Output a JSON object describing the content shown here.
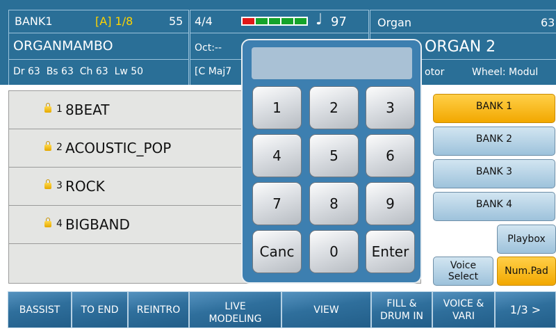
{
  "style_info": {
    "bank": "BANK1",
    "position": "[A] 1/8",
    "number": "55",
    "name": "ORGANMAMBO",
    "levels": "Dr 63  Bs 63  Ch 63  Lw 50"
  },
  "song_info": {
    "time_signature": "4/4",
    "tempo": "97",
    "octave": "Oct:--",
    "chord": "[C Maj7"
  },
  "voice_info": {
    "name": "Organ",
    "number": "63",
    "voice_title": "ORGAN 2",
    "rotor": "otor",
    "wheel": "Wheel: Modul"
  },
  "styles": [
    {
      "num": "1",
      "name": "8BEAT"
    },
    {
      "num": "2",
      "name": "ACOUSTIC_POP"
    },
    {
      "num": "3",
      "name": "ROCK"
    },
    {
      "num": "4",
      "name": "BIGBAND"
    }
  ],
  "numpad": {
    "display": "",
    "keys": [
      "1",
      "2",
      "3",
      "4",
      "5",
      "6",
      "7",
      "8",
      "9",
      "Canc",
      "0",
      "Enter"
    ]
  },
  "banks": [
    "BANK 1",
    "BANK 2",
    "BANK 3",
    "BANK 4"
  ],
  "side_buttons": {
    "playbox": "Playbox",
    "voice_select_1": "Voice",
    "voice_select_2": "Select",
    "numpad": "Num.Pad"
  },
  "tabs": {
    "bassist": "BASSIST",
    "to_end": "TO END",
    "reintro": "REINTRO",
    "live_1": "LIVE",
    "live_2": "MODELING",
    "view": "VIEW",
    "fill_1": "FILL &",
    "fill_2": "DRUM IN",
    "voice_1": "VOICE &",
    "voice_2": "VARI",
    "page": "1/3 >"
  },
  "colors": {
    "header_blue": "#2a6f97",
    "accent_yellow": "#ffd400",
    "selected_orange": "#f5b000",
    "meter": [
      "#e01818",
      "#15a32a",
      "#15a32a",
      "#15a32a",
      "#15a32a"
    ]
  }
}
